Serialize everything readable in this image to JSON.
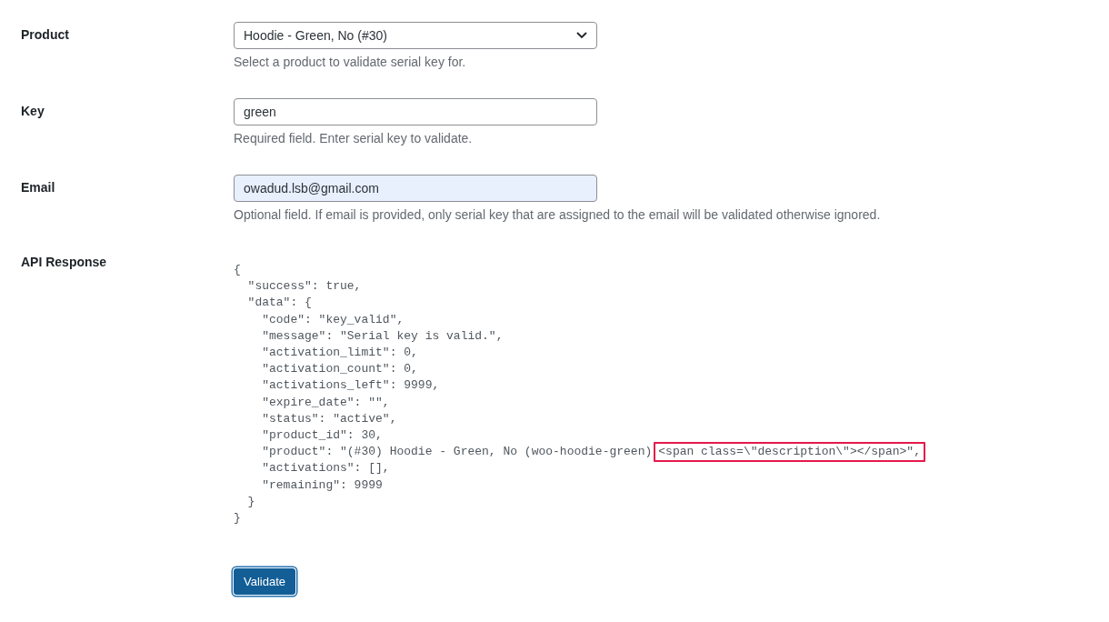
{
  "fields": [
    {
      "kind": "select",
      "label": "Product",
      "value": "Hoodie - Green, No (#30)",
      "description": "Select a product to validate serial key for.",
      "autofilled": false
    },
    {
      "kind": "text",
      "label": "Key",
      "value": "green",
      "description": "Required field. Enter serial key to validate.",
      "autofilled": false
    },
    {
      "kind": "text",
      "label": "Email",
      "value": "owadud.lsb@gmail.com",
      "description": "Optional field. If email is provided, only serial key that are assigned to the email will be validated otherwise ignored.",
      "autofilled": true
    }
  ],
  "api_response": {
    "label": "API Response",
    "lines": [
      {
        "text": "{"
      },
      {
        "text": "  \"success\": true,"
      },
      {
        "text": "  \"data\": {"
      },
      {
        "text": "    \"code\": \"key_valid\","
      },
      {
        "text": "    \"message\": \"Serial key is valid.\","
      },
      {
        "text": "    \"activation_limit\": 0,"
      },
      {
        "text": "    \"activation_count\": 0,"
      },
      {
        "text": "    \"activations_left\": 9999,"
      },
      {
        "text": "    \"expire_date\": \"\","
      },
      {
        "text": "    \"status\": \"active\","
      },
      {
        "text": "    \"product_id\": 30,"
      },
      {
        "text": "    \"product\": \"(#30) Hoodie - Green, No (woo-hoodie-green)",
        "highlight": "<span class=\\\"description\\\"></span>\","
      },
      {
        "text": "    \"activations\": [],"
      },
      {
        "text": "    \"remaining\": 9999"
      },
      {
        "text": "  }"
      },
      {
        "text": "}"
      }
    ]
  },
  "button": "Validate"
}
